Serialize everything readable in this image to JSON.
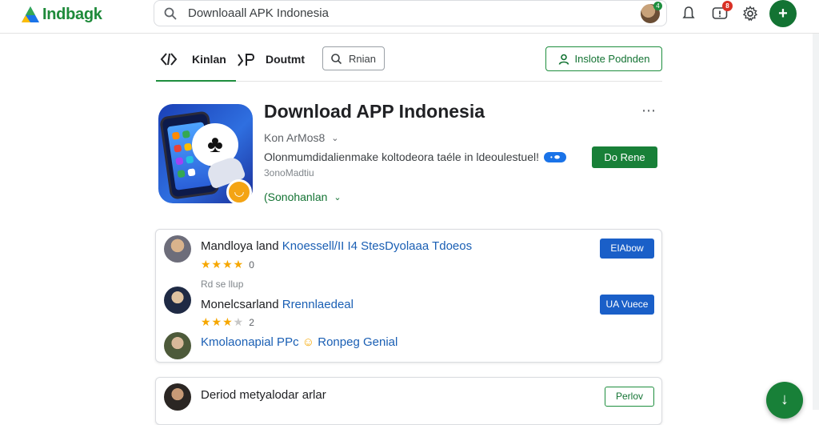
{
  "brand": {
    "name": "Indbagk",
    "color": "#1e8a3a"
  },
  "search": {
    "value": "Downloaall APK Indonesia",
    "icon": "search-icon"
  },
  "topbar": {
    "avatar_badge": "4",
    "notifications_badge": "8",
    "add_label": "+"
  },
  "nav": {
    "items": [
      "Kinlan",
      "Doutmt"
    ],
    "chip_label": "Rnian",
    "install_label": "Inslote Podnden"
  },
  "app": {
    "title": "Download APP Indonesia",
    "developer": "Kon ArMos8",
    "description": "Olonmumdidalienmake koltodeora taéle in ldeoulestuel!",
    "chip": "AP",
    "meta": "3onoMadtiu",
    "see_more": "(Sonohanlan",
    "primary_button": "Do Rene",
    "more_icon": "⋯"
  },
  "reviews": [
    {
      "name": "Mandloya land",
      "highlight": "Knoessell/II I4 StesDyolaaa Tdoeos",
      "stars": 4,
      "count": "0",
      "note": "Rd se llup",
      "button": "EIAbow"
    },
    {
      "name": "Monelcsarland",
      "highlight": "Rrennlaedeal",
      "stars": 3,
      "count": "2",
      "button": "UA Vuece"
    },
    {
      "name": "",
      "highlight": "Kmolaonapial PPc",
      "tail": "Ronpeg Genial"
    }
  ],
  "review_card_2": {
    "name": "Deriod metyalodar arlar",
    "button": "Perlov"
  },
  "fab_label": "↓",
  "colors": {
    "accent_green": "#188038",
    "accent_blue": "#1a5fc8",
    "star": "#f6a700"
  }
}
